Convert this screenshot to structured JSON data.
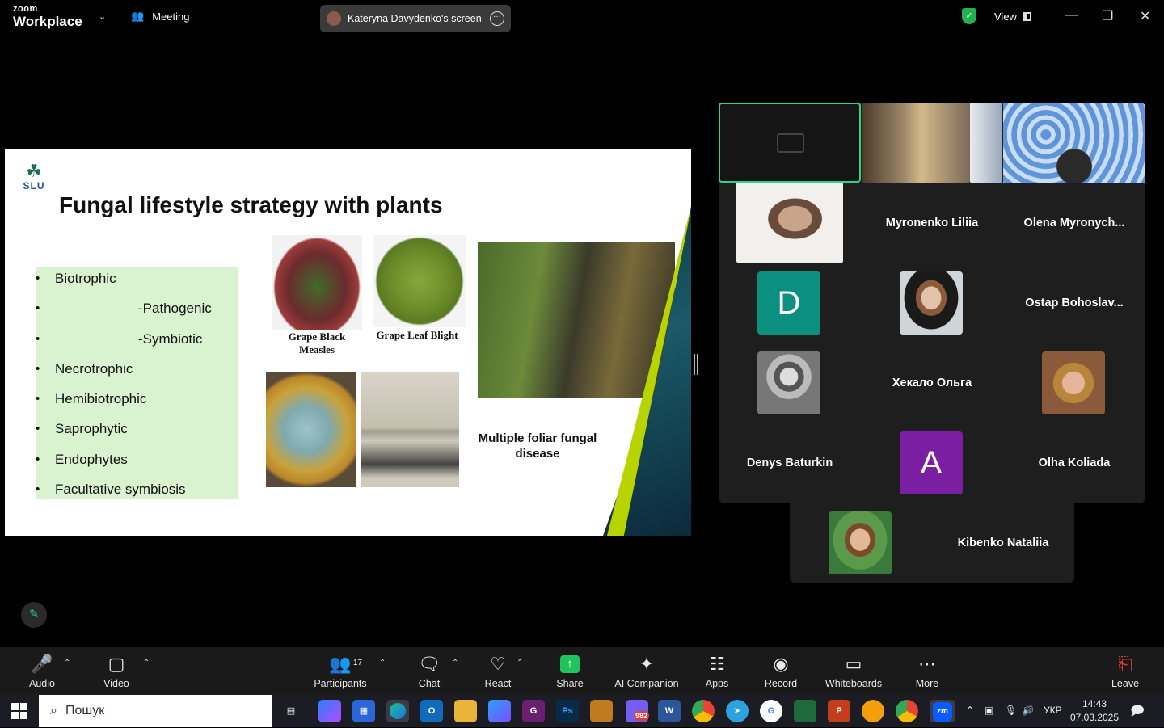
{
  "app": {
    "brand_top": "zoom",
    "brand_bottom": "Workplace"
  },
  "header": {
    "meeting_label": "Meeting",
    "share_label": "Kateryna Davydenko's screen",
    "view_label": "View"
  },
  "slide": {
    "logo_text": "SLU",
    "title": "Fungal lifestyle strategy with plants",
    "bullets": [
      "Biotrophic",
      "-Pathogenic",
      "-Symbiotic",
      "Necrotrophic",
      "Hemibiotrophic",
      "Saprophytic",
      "Endophytes",
      "Facultative symbiosis"
    ],
    "captions": {
      "grape_black_measles": "Grape Black Measles",
      "grape_leaf_blight": "Grape Leaf Blight",
      "foliar": "Multiple foliar fungal disease"
    }
  },
  "gallery": {
    "participants": [
      "Myronenko Liliia",
      "Olena  Myronych...",
      "Ostap  Bohoslav...",
      "Хекало Ольга",
      "Denys Baturkin",
      "Olha Koliada",
      "Kibenko Nataliia"
    ],
    "avatar_letters": [
      "D",
      "A"
    ]
  },
  "toolbar": {
    "audio": "Audio",
    "video": "Video",
    "participants": "Participants",
    "participants_count": "17",
    "chat": "Chat",
    "react": "React",
    "share": "Share",
    "ai_companion": "AI Companion",
    "apps": "Apps",
    "record": "Record",
    "whiteboards": "Whiteboards",
    "more": "More",
    "leave": "Leave"
  },
  "taskbar": {
    "search_placeholder": "Пошук",
    "viber_badge": "982",
    "language": "УКР",
    "time": "14:43",
    "date": "07.03.2025"
  },
  "colors": {
    "accent_green": "#2dd38d",
    "share_green": "#21c45c",
    "avatar_d": "#0b8f7f",
    "avatar_a": "#7b1fa2",
    "bullet_box": "#d9f2d0"
  }
}
